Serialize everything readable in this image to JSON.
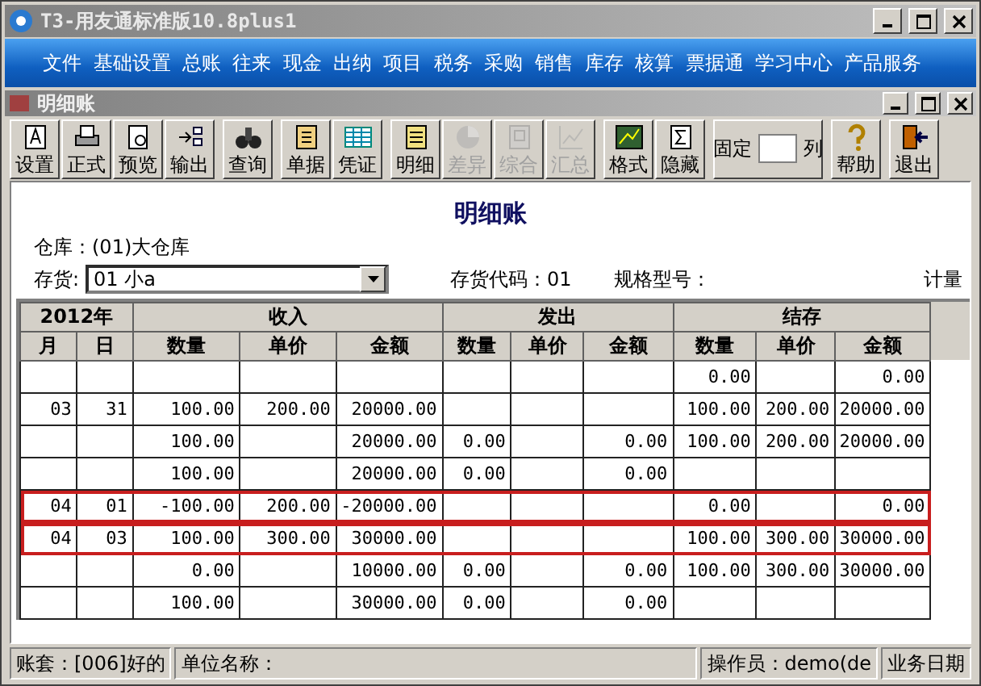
{
  "window": {
    "title": "T3-用友通标准版10.8plus1"
  },
  "menu": [
    "文件",
    "基础设置",
    "总账",
    "往来",
    "现金",
    "出纳",
    "项目",
    "税务",
    "采购",
    "销售",
    "库存",
    "核算",
    "票据通",
    "学习中心",
    "产品服务"
  ],
  "child_window": {
    "title": "明细账"
  },
  "toolbar": [
    [
      {
        "label": "设置",
        "disabled": false
      },
      {
        "label": "正式",
        "disabled": false
      },
      {
        "label": "预览",
        "disabled": false
      },
      {
        "label": "输出",
        "disabled": false
      }
    ],
    [
      {
        "label": "查询",
        "disabled": false
      }
    ],
    [
      {
        "label": "单据",
        "disabled": false
      },
      {
        "label": "凭证",
        "disabled": false
      }
    ],
    [
      {
        "label": "明细",
        "disabled": false
      },
      {
        "label": "差异",
        "disabled": true
      },
      {
        "label": "综合",
        "disabled": true
      },
      {
        "label": "汇总",
        "disabled": true
      }
    ],
    [
      {
        "label": "格式",
        "disabled": false
      },
      {
        "label": "隐藏",
        "disabled": false
      }
    ],
    [
      {
        "kind": "fixed",
        "label_before": "固定",
        "label_after": "列"
      }
    ],
    [
      {
        "label": "帮助",
        "disabled": false
      }
    ],
    [
      {
        "label": "退出",
        "disabled": false
      }
    ]
  ],
  "report": {
    "title": "明细账",
    "warehouse_label": "仓库：",
    "warehouse": "(01)大仓库",
    "item_label": "存货:",
    "item_value": "01 小a",
    "item_code": "存货代码：01",
    "spec": "规格型号：",
    "unit": "计量"
  },
  "table": {
    "year": "2012年",
    "groups": [
      "收入",
      "发出",
      "结存"
    ],
    "columns": [
      "月",
      "日",
      "数量",
      "单价",
      "金额",
      "数量",
      "单价",
      "金额",
      "数量",
      "单价",
      "金额"
    ],
    "rows": [
      {
        "highlighted": false,
        "cells": [
          "",
          "",
          "",
          "",
          "",
          "",
          "",
          "",
          "0.00",
          "",
          "0.00"
        ]
      },
      {
        "highlighted": false,
        "cells": [
          "03",
          "31",
          "100.00",
          "200.00",
          "20000.00",
          "",
          "",
          "",
          "100.00",
          "200.00",
          "20000.00"
        ]
      },
      {
        "highlighted": false,
        "cells": [
          "",
          "",
          "100.00",
          "",
          "20000.00",
          "0.00",
          "",
          "0.00",
          "100.00",
          "200.00",
          "20000.00"
        ]
      },
      {
        "highlighted": false,
        "cells": [
          "",
          "",
          "100.00",
          "",
          "20000.00",
          "0.00",
          "",
          "0.00",
          "",
          "",
          ""
        ]
      },
      {
        "highlighted": true,
        "cells": [
          "04",
          "01",
          "-100.00",
          "200.00",
          "-20000.00",
          "",
          "",
          "",
          "0.00",
          "",
          "0.00"
        ]
      },
      {
        "highlighted": true,
        "cells": [
          "04",
          "03",
          "100.00",
          "300.00",
          "30000.00",
          "",
          "",
          "",
          "100.00",
          "300.00",
          "30000.00"
        ]
      },
      {
        "highlighted": false,
        "cells": [
          "",
          "",
          "0.00",
          "",
          "10000.00",
          "0.00",
          "",
          "0.00",
          "100.00",
          "300.00",
          "30000.00"
        ]
      },
      {
        "highlighted": false,
        "cells": [
          "",
          "",
          "100.00",
          "",
          "30000.00",
          "0.00",
          "",
          "0.00",
          "",
          "",
          ""
        ]
      }
    ]
  },
  "status_bar": [
    "账套：[006]好的",
    "单位名称：",
    "操作员：demo(de",
    "业务日期"
  ]
}
